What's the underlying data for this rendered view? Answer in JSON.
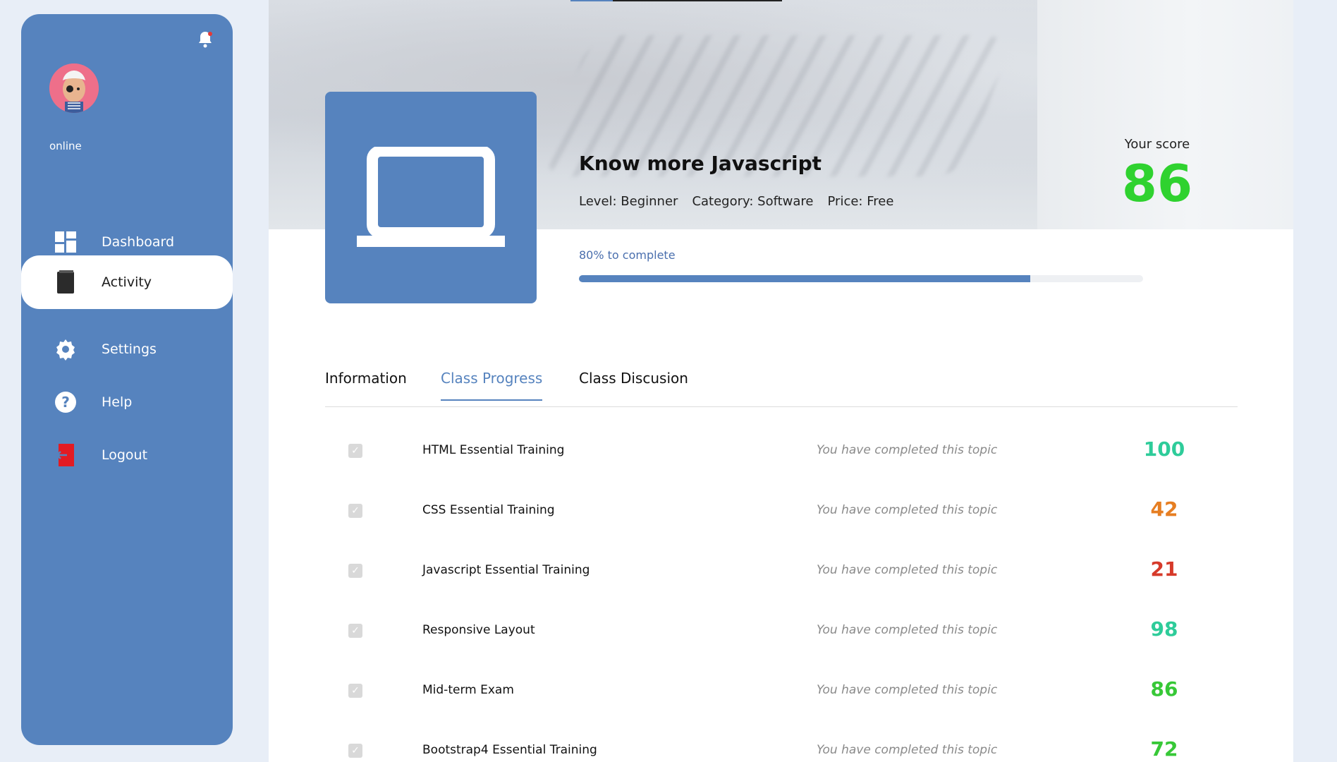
{
  "sidebar": {
    "status": "online",
    "items": [
      {
        "label": "Dashboard",
        "icon": "grid-icon"
      },
      {
        "label": "Activity",
        "icon": "book-icon",
        "active": true
      },
      {
        "label": "Settings",
        "icon": "gear-icon"
      },
      {
        "label": "Help",
        "icon": "help-icon"
      },
      {
        "label": "Logout",
        "icon": "logout-icon"
      }
    ]
  },
  "course": {
    "title": "Know more Javascript",
    "level": "Level: Beginner",
    "category": "Category: Software",
    "price": "Price: Free",
    "progress_text": "80% to complete",
    "progress_fraction": 0.8
  },
  "score": {
    "label": "Your score",
    "value": "86"
  },
  "tabs": [
    {
      "label": "Information"
    },
    {
      "label": "Class Progress",
      "active": true
    },
    {
      "label": "Class Discusion"
    }
  ],
  "topics": [
    {
      "name": "HTML Essential Training",
      "status": "You have completed this topic",
      "score": "100",
      "color": "#2ecc9a"
    },
    {
      "name": "CSS Essential Training",
      "status": "You have completed this topic",
      "score": "42",
      "color": "#e67e22"
    },
    {
      "name": "Javascript Essential Training",
      "status": "You have completed this topic",
      "score": "21",
      "color": "#d63a2a"
    },
    {
      "name": "Responsive Layout",
      "status": "You have completed this topic",
      "score": "98",
      "color": "#2ecc9a"
    },
    {
      "name": "Mid-term Exam",
      "status": "You have completed this topic",
      "score": "86",
      "color": "#37c837"
    },
    {
      "name": "Bootstrap4 Essential Training",
      "status": "You have completed this topic",
      "score": "72",
      "color": "#37c837"
    }
  ],
  "colors": {
    "accent": "#5683be",
    "score_green": "#2fd22f"
  }
}
